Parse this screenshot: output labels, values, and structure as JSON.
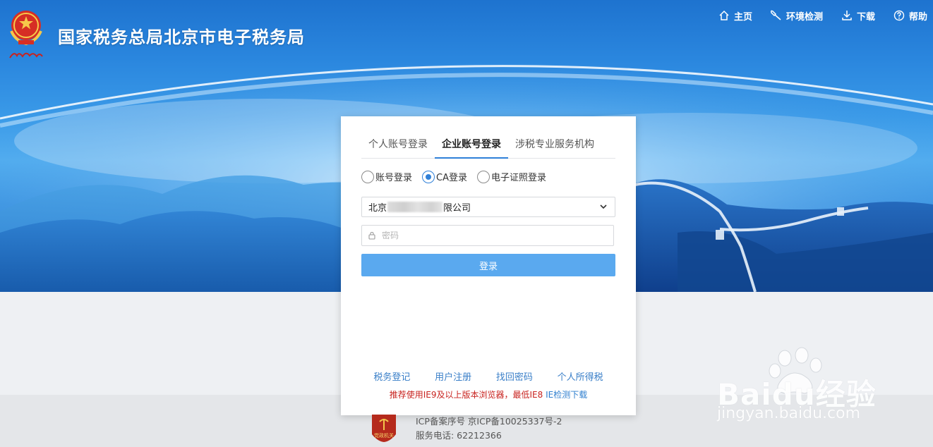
{
  "header": {
    "site_title": "国家税务总局北京市电子税务局",
    "emblem_signature": "中国税务",
    "nav": [
      {
        "label": "主页",
        "icon": "home-icon"
      },
      {
        "label": "环境检测",
        "icon": "wrench-icon"
      },
      {
        "label": "下载",
        "icon": "download-icon"
      },
      {
        "label": "帮助",
        "icon": "help-icon"
      }
    ]
  },
  "login": {
    "tabs": [
      {
        "label": "个人账号登录",
        "active": false
      },
      {
        "label": "企业账号登录",
        "active": true
      },
      {
        "label": "涉税专业服务机构",
        "active": false
      }
    ],
    "methods": [
      {
        "label": "账号登录",
        "checked": false
      },
      {
        "label": "CA登录",
        "checked": true
      },
      {
        "label": "电子证照登录",
        "checked": false
      }
    ],
    "company_prefix": "北京",
    "company_suffix": "限公司",
    "password_placeholder": "密码",
    "submit_label": "登录",
    "links": [
      "税务登记",
      "用户注册",
      "找回密码",
      "个人所得税"
    ],
    "notice_text": "推荐使用IE9及以上版本浏览器，最低IE8",
    "notice_link": "IE检测下载"
  },
  "footer": {
    "badge_text": "党政机关",
    "icp": "ICP备案序号 京ICP备10025337号-2",
    "phone": "服务电话: 62212366"
  },
  "watermark": {
    "brand": "Baidu经验",
    "url": "jingyan.baidu.com"
  },
  "colors": {
    "primary": "#2f80d8",
    "button": "#5aa9ef",
    "link": "#3a7fc8",
    "notice_red": "#c8231f",
    "hero_top": "#1e73cf"
  }
}
